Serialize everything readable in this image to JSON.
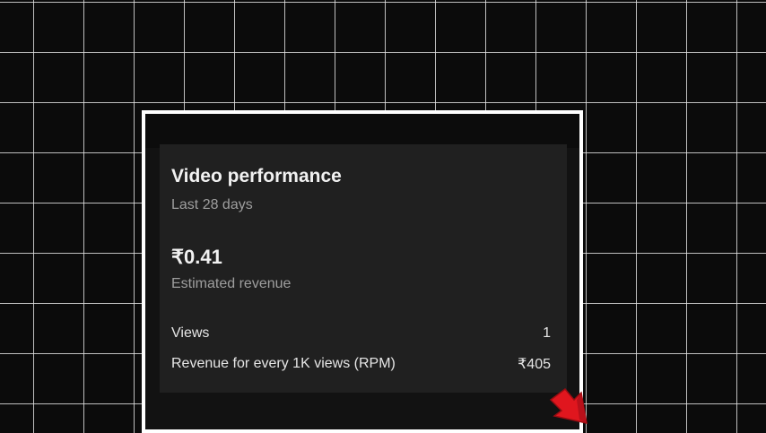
{
  "card": {
    "title": "Video performance",
    "subtitle": "Last 28 days",
    "revenue": {
      "value": "₹0.41",
      "label": "Estimated revenue"
    },
    "metrics": [
      {
        "label": "Views",
        "value": "1"
      },
      {
        "label": "Revenue for every 1K views (RPM)",
        "value": "₹405"
      }
    ]
  },
  "colors": {
    "background": "#0b0b0b",
    "grid": "#e6e6e6",
    "highlight_frame": "#ffffff",
    "card": "#202020",
    "pointer": "#e0161e"
  },
  "icons": {
    "pointer": "red-arrow-icon"
  }
}
